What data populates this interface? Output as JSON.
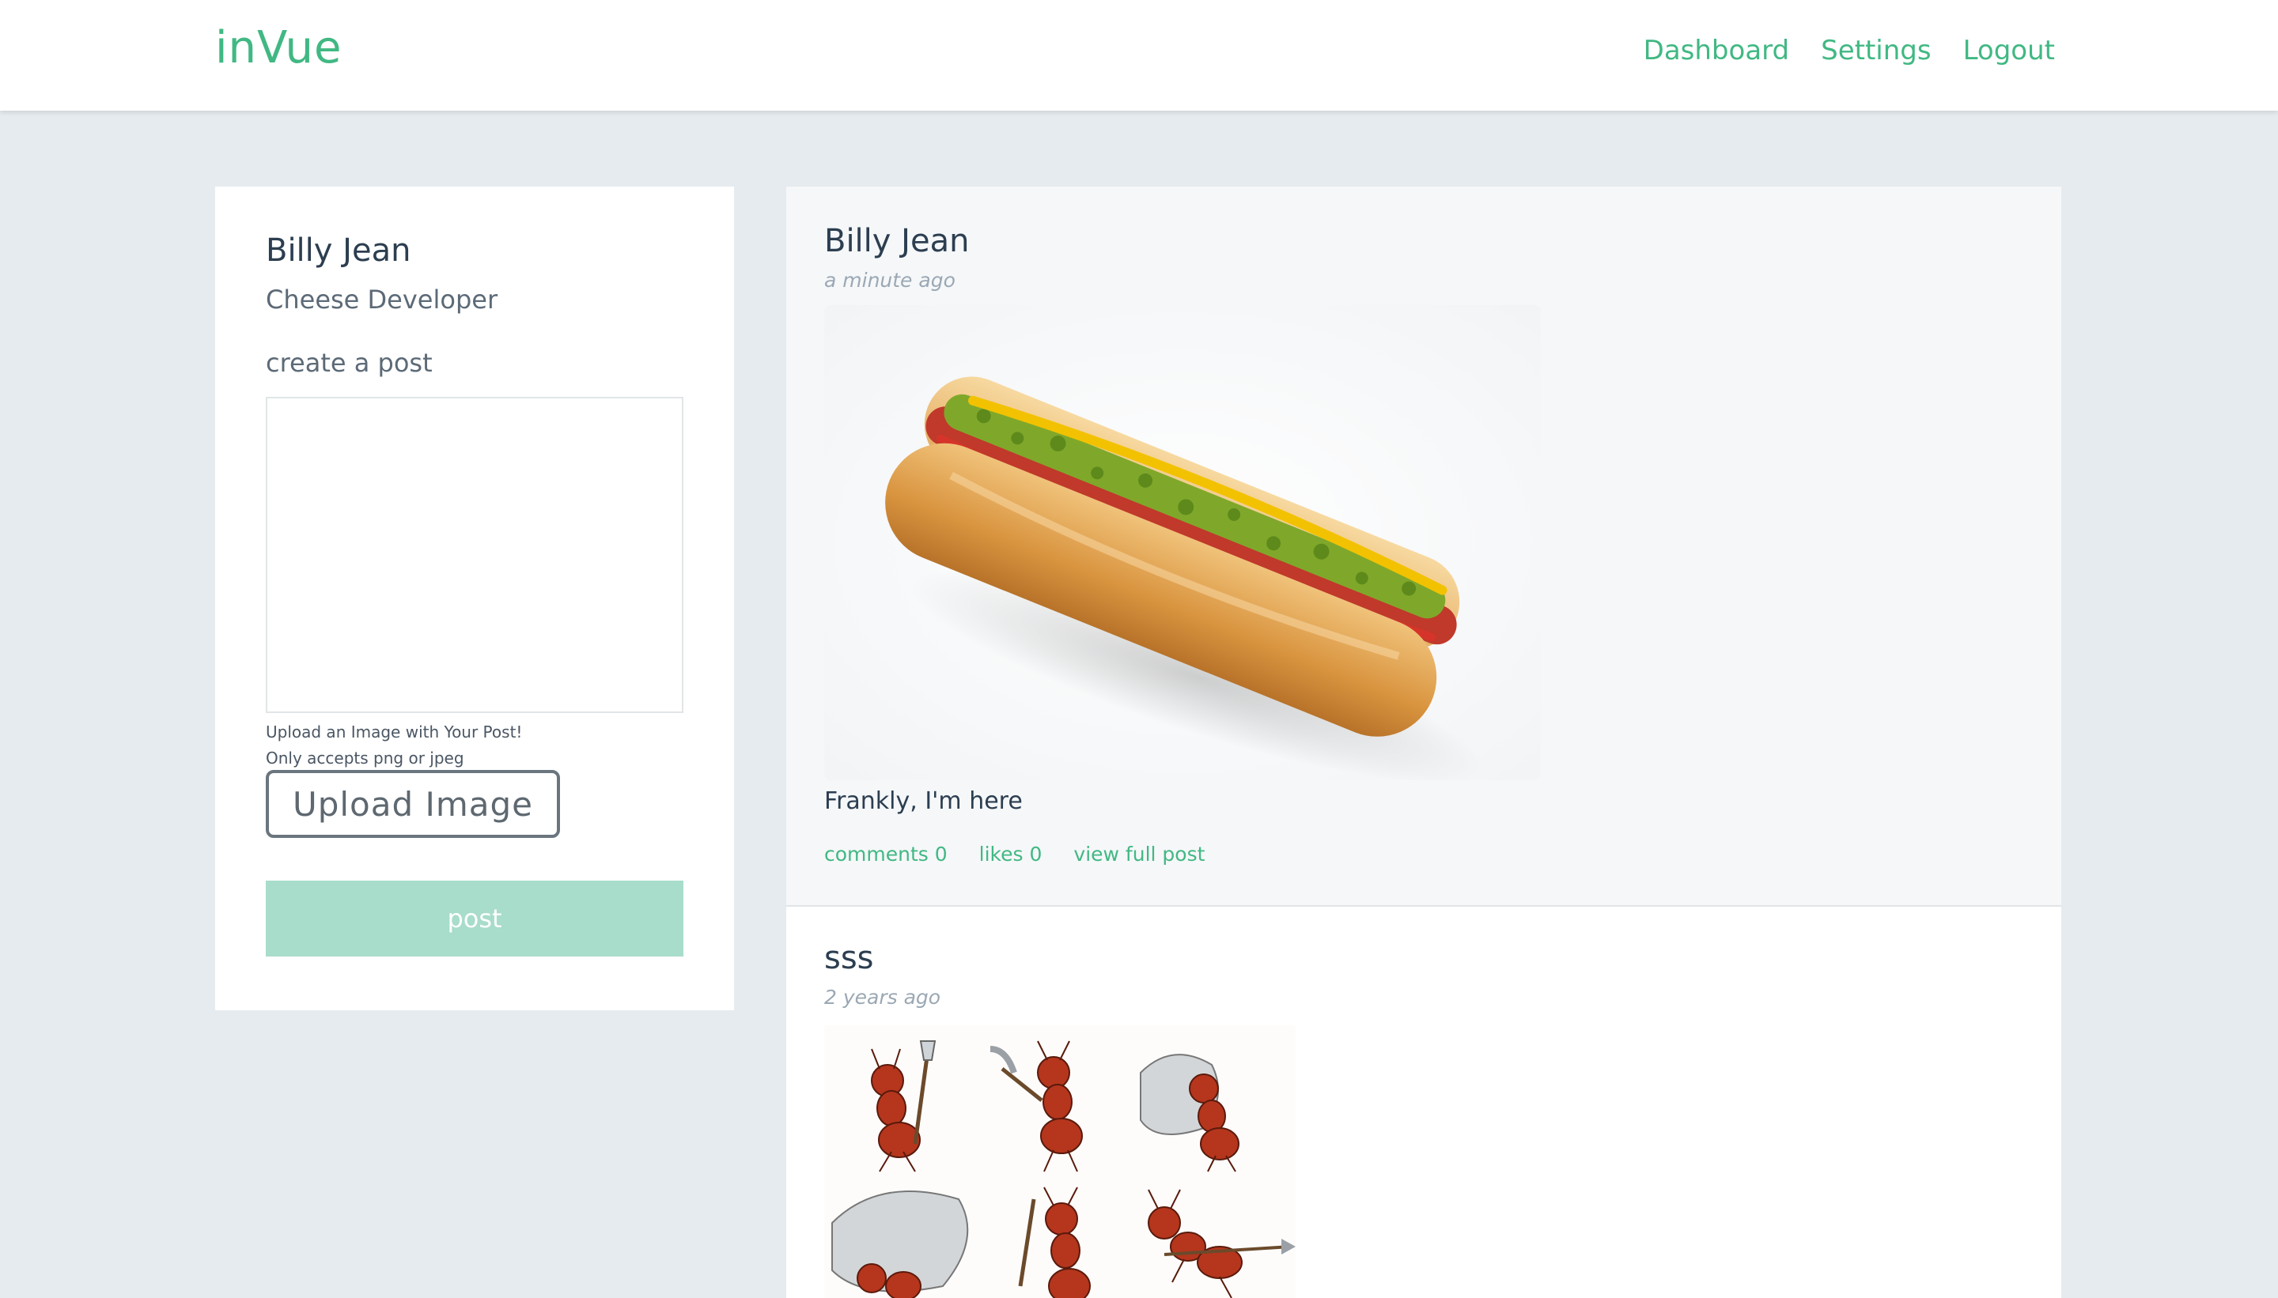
{
  "header": {
    "logo": "inVue",
    "nav": [
      "Dashboard",
      "Settings",
      "Logout"
    ]
  },
  "sidebar": {
    "name": "Billy Jean",
    "title": "Cheese Developer",
    "create_label": "create a post",
    "textarea_value": "",
    "upload_hint_line1": "Upload an Image with Your Post!",
    "upload_hint_line2": "Only accepts png or jpeg",
    "upload_button": "Upload Image",
    "post_button": "post"
  },
  "feed": {
    "posts": [
      {
        "author": "Billy Jean",
        "time": "a minute ago",
        "image_alt": "hot dog",
        "text": "Frankly, I'm here",
        "actions": [
          "comments 0",
          "likes 0",
          "view full post"
        ]
      },
      {
        "author": "sss",
        "time": "2 years ago",
        "image_alt": "cartoon ants"
      }
    ]
  },
  "colors": {
    "accent": "#41b883",
    "post_button_disabled": "#a8dccb",
    "page_background": "#e6ebef",
    "text_dark": "#2c3e50",
    "timestamp": "#9ba8b4"
  }
}
